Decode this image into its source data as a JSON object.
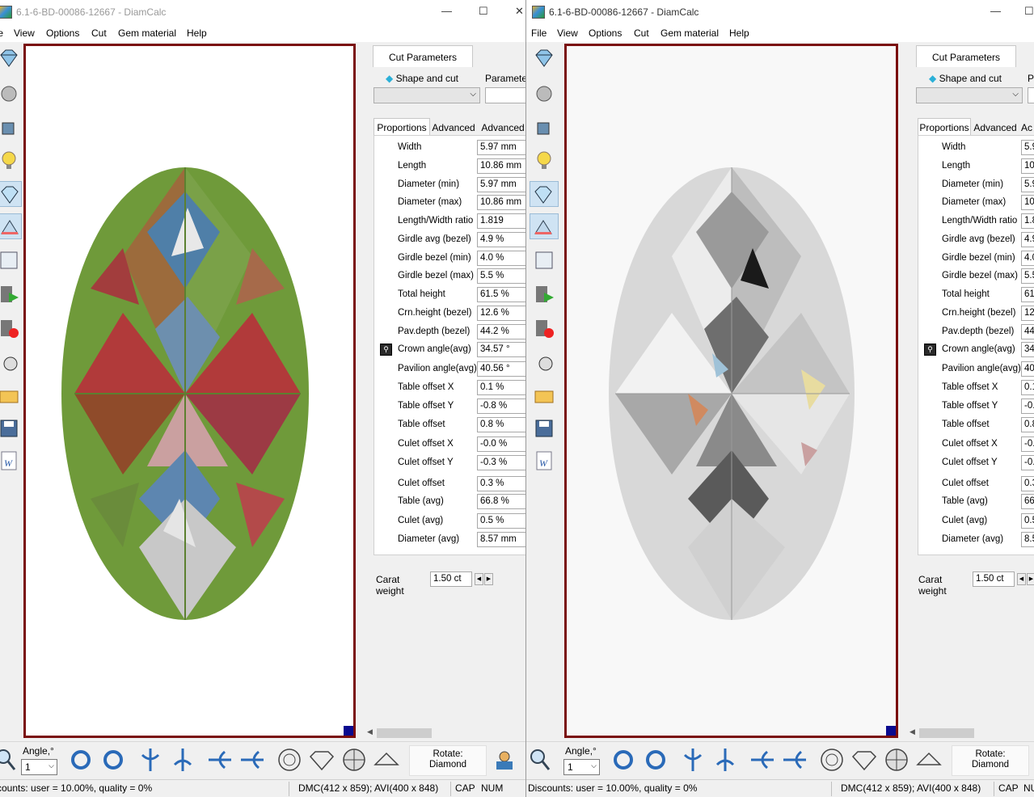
{
  "left_window": {
    "title": "6.1-6-BD-00086-12667 - DiamCalc",
    "menu": [
      "ile",
      "View",
      "Options",
      "Cut",
      "Gem material",
      "Help"
    ],
    "panel_tab": "Cut Parameters",
    "shape_label": "Shape and cut",
    "parameters_label": "Parameter",
    "subtabs": [
      "Proportions",
      "Advanced",
      "Advanced"
    ],
    "carat_label": "Carat weight",
    "carat_value": "1.50 ct",
    "angle_label": "Angle,°",
    "angle_value": "1",
    "rotate_line1": "Rotate:",
    "rotate_line2": "Diamond",
    "status_discounts": "counts: user = 10.00%, quality = 0%",
    "status_dmc": "DMC(412 x 859); AVI(400 x 848)",
    "status_cap": "CAP",
    "status_num": "NUM",
    "render_style": "color"
  },
  "right_window": {
    "title": "6.1-6-BD-00086-12667 - DiamCalc",
    "menu": [
      "File",
      "View",
      "Options",
      "Cut",
      "Gem material",
      "Help"
    ],
    "panel_tab": "Cut Parameters",
    "shape_label": "Shape and cut",
    "parameters_label": "P",
    "subtabs": [
      "Proportions",
      "Advanced",
      "Ac"
    ],
    "carat_label": "Carat weight",
    "carat_value": "1.50 ct",
    "angle_label": "Angle,°",
    "angle_value": "1",
    "rotate_line1": "Rotate:",
    "rotate_line2": "Diamond",
    "status_discounts": "Discounts: user = 10.00%, quality = 0%",
    "status_dmc": "DMC(412 x 859); AVI(400 x 848)",
    "status_cap": "CAP",
    "status_num": "NU",
    "render_style": "gray"
  },
  "proportions_left": [
    {
      "label": "Width",
      "value": "5.97 mm"
    },
    {
      "label": "Length",
      "value": "10.86 mm"
    },
    {
      "label": "Diameter (min)",
      "value": "5.97 mm"
    },
    {
      "label": "Diameter (max)",
      "value": "10.86 mm"
    },
    {
      "label": "Length/Width ratio",
      "value": "1.819"
    },
    {
      "label": "Girdle avg (bezel)",
      "value": "4.9 %"
    },
    {
      "label": "Girdle bezel (min)",
      "value": "4.0 %"
    },
    {
      "label": "Girdle bezel (max)",
      "value": "5.5 %"
    },
    {
      "label": "Total height",
      "value": "61.5 %"
    },
    {
      "label": "Crn.height (bezel)",
      "value": "12.6 %"
    },
    {
      "label": "Pav.depth (bezel)",
      "value": "44.2 %"
    },
    {
      "label": "Crown angle(avg)",
      "value": "34.57 °",
      "locked": true
    },
    {
      "label": "Pavilion angle(avg)",
      "value": "40.56 °"
    },
    {
      "label": "Table offset X",
      "value": "0.1 %"
    },
    {
      "label": "Table offset Y",
      "value": "-0.8 %"
    },
    {
      "label": "Table offset",
      "value": "0.8 %"
    },
    {
      "label": "Culet offset X",
      "value": "-0.0 %"
    },
    {
      "label": "Culet offset Y",
      "value": "-0.3 %"
    },
    {
      "label": "Culet offset",
      "value": "0.3 %"
    },
    {
      "label": "Table (avg)",
      "value": "66.8 %"
    },
    {
      "label": "Culet (avg)",
      "value": "0.5 %"
    },
    {
      "label": "Diameter (avg)",
      "value": "8.57 mm"
    }
  ],
  "proportions_right": [
    {
      "label": "Width",
      "value": "5.9"
    },
    {
      "label": "Length",
      "value": "10"
    },
    {
      "label": "Diameter (min)",
      "value": "5.9"
    },
    {
      "label": "Diameter (max)",
      "value": "10"
    },
    {
      "label": "Length/Width ratio",
      "value": "1.8"
    },
    {
      "label": "Girdle avg (bezel)",
      "value": "4.9"
    },
    {
      "label": "Girdle bezel (min)",
      "value": "4.0"
    },
    {
      "label": "Girdle bezel (max)",
      "value": "5.5"
    },
    {
      "label": "Total height",
      "value": "61"
    },
    {
      "label": "Crn.height (bezel)",
      "value": "12"
    },
    {
      "label": "Pav.depth (bezel)",
      "value": "44"
    },
    {
      "label": "Crown angle(avg)",
      "value": "34",
      "locked": true
    },
    {
      "label": "Pavilion angle(avg)",
      "value": "40"
    },
    {
      "label": "Table offset X",
      "value": "0.1"
    },
    {
      "label": "Table offset Y",
      "value": "-0."
    },
    {
      "label": "Table offset",
      "value": "0.8"
    },
    {
      "label": "Culet offset X",
      "value": "-0."
    },
    {
      "label": "Culet offset Y",
      "value": "-0."
    },
    {
      "label": "Culet offset",
      "value": "0.3"
    },
    {
      "label": "Table (avg)",
      "value": "66"
    },
    {
      "label": "Culet (avg)",
      "value": "0.5"
    },
    {
      "label": "Diameter (avg)",
      "value": "8.5"
    }
  ],
  "toolbar_icons": [
    "diamond-icon",
    "gem-sphere-icon",
    "paint-bucket-icon",
    "lightbulb-icon",
    "diamond-light-icon",
    "spectrum-icon",
    "diamond-photo-icon",
    "video-play-icon",
    "video-record-icon",
    "camera-reel-icon",
    "open-folder-icon",
    "save-icon",
    "word-export-icon"
  ],
  "bottom_icons": [
    "rotate-cw-icon",
    "rotate-ccw-icon",
    "flip-v-icon",
    "flip-v2-icon",
    "flip-h-icon",
    "flip-h2-icon",
    "top-view-icon",
    "side-view-icon",
    "bottom-view-icon",
    "tilt-view-icon"
  ],
  "colors": {
    "frame": "#7a0e0e",
    "corner": "#0a0a8f"
  }
}
